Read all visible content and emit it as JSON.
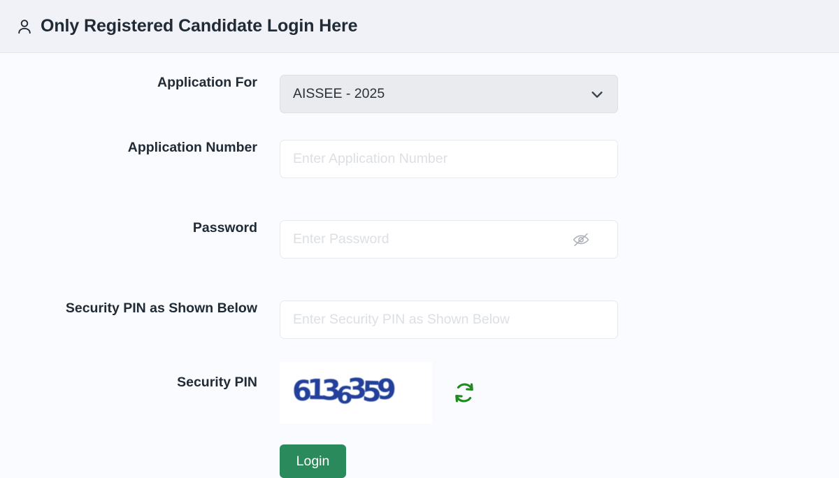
{
  "header": {
    "icon": "user-icon",
    "title": "Only Registered Candidate Login Here"
  },
  "form": {
    "application_for": {
      "label": "Application For",
      "selected_value": "AISSEE - 2025",
      "chevron_icon": "chevron-down-icon"
    },
    "application_number": {
      "label": "Application Number",
      "placeholder": "Enter Application Number",
      "value": ""
    },
    "password": {
      "label": "Password",
      "placeholder": "Enter Password",
      "value": "",
      "toggle_icon": "eye-slash-icon"
    },
    "security_pin_input": {
      "label": "Security PIN as Shown Below",
      "placeholder": "Enter Security PIN as Shown Below",
      "value": ""
    },
    "security_pin_image": {
      "label": "Security PIN",
      "captcha_text": "6136359",
      "refresh_icon": "refresh-icon"
    },
    "submit": {
      "label": "Login"
    }
  },
  "colors": {
    "header_bg": "#f1f2f7",
    "page_bg": "#fafbfe",
    "select_bg": "#e9ebef",
    "captcha_text": "#23409a",
    "refresh_green": "#1f8b1f",
    "login_green": "#2a8a5b"
  }
}
